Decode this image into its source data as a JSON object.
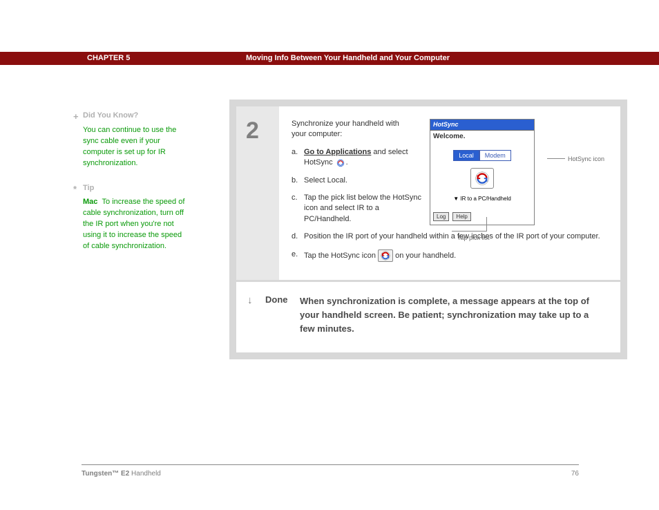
{
  "header": {
    "chapter": "CHAPTER 5",
    "title": "Moving Info Between Your Handheld and Your Computer"
  },
  "sidebar": {
    "didyouknow": {
      "title": "Did You Know?",
      "body": "You can continue to use the sync cable even if your computer is set up for IR synchronization."
    },
    "tip": {
      "title": "Tip",
      "mac": "Mac",
      "body": "To increase the speed of cable synchronization, turn off the IR port when you're not using it to increase the speed of cable synchronization."
    }
  },
  "step": {
    "number": "2",
    "intro": "Synchronize your handheld with your computer:",
    "items": {
      "a_pre": "a.",
      "a_link": "Go to Applications",
      "a_post1": " and select HotSync ",
      "a_post2": ".",
      "b_pre": "b.",
      "b_text": "Select Local.",
      "c_pre": "c.",
      "c_text": "Tap the pick list below the HotSync icon and select IR to a PC/Handheld.",
      "d_pre": "d.",
      "d_text": "Position the IR port of your handheld within a few inches of the IR port of your computer.",
      "e_pre": "e.",
      "e_text1": "Tap the HotSync icon ",
      "e_text2": " on your handheld."
    }
  },
  "device": {
    "title": "HotSync",
    "welcome": "Welcome.",
    "tab_local": "Local",
    "tab_modem": "Modem",
    "picklist": "IR to a PC/Handheld",
    "btn_log": "Log",
    "btn_help": "Help"
  },
  "callouts": {
    "icon": "HotSync icon",
    "picklist": "Tap pick list"
  },
  "done": {
    "label": "Done",
    "text": "When synchronization is complete, a message appears at the top of your handheld screen. Be patient; synchronization may take up to a few minutes."
  },
  "footer": {
    "product_bold": "Tungsten™ E2",
    "product_rest": " Handheld",
    "page": "76"
  }
}
